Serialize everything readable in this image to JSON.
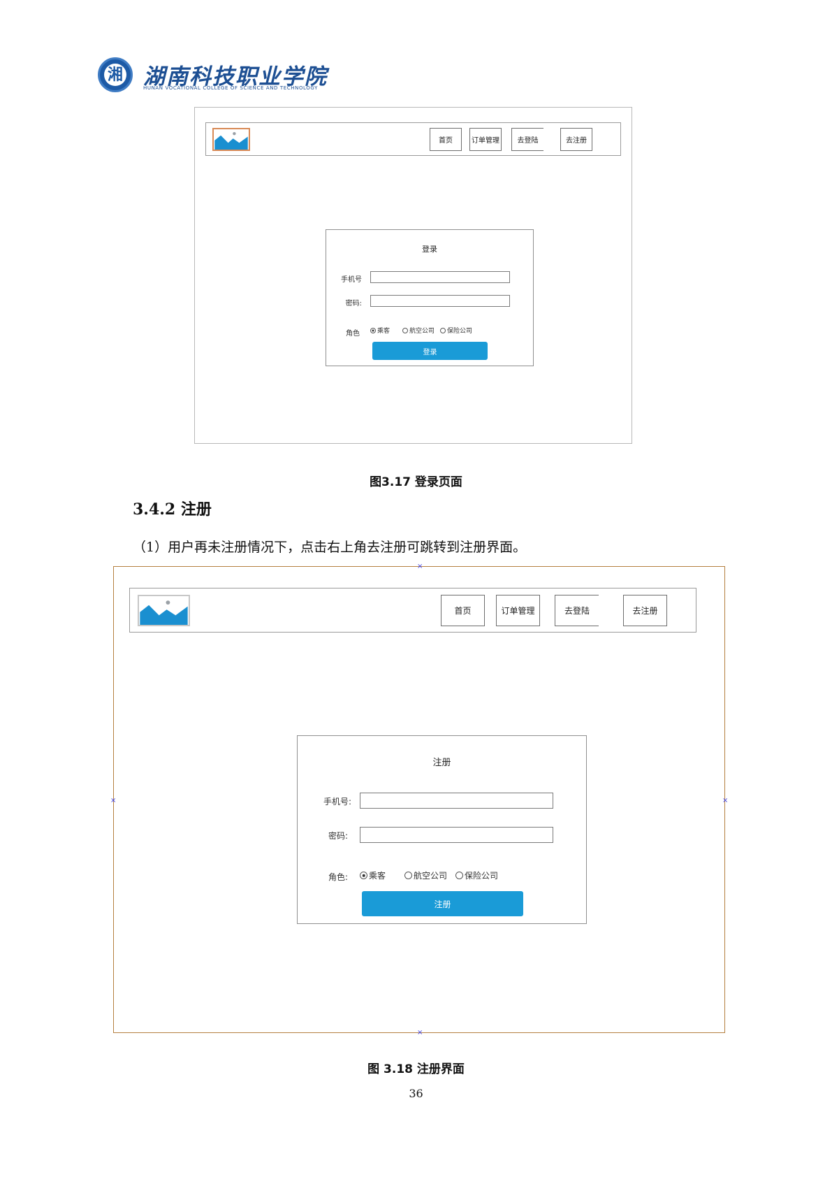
{
  "header": {
    "emblem_char": "湘",
    "college_name_cn": "湖南科技职业学院",
    "college_name_en": "HUNAN VOCATIONAL COLLEGE OF SCIENCE AND TECHNOLOGY"
  },
  "figure_login": {
    "nav": [
      "首页",
      "订单管理",
      "去登陆",
      "去注册"
    ],
    "form_title": "登录",
    "phone_label": "手机号",
    "password_label": "密码:",
    "role_label": "角色",
    "roles": [
      "乘客",
      "航空公司",
      "保险公司"
    ],
    "submit_label": "登录",
    "caption": "图3.17 登录页面"
  },
  "section": {
    "heading": "3.4.2 注册",
    "paragraph": "（1）用户再未注册情况下，点击右上角去注册可跳转到注册界面。"
  },
  "figure_register": {
    "nav": [
      "首页",
      "订单管理",
      "去登陆",
      "去注册"
    ],
    "form_title": "注册",
    "phone_label": "手机号:",
    "password_label": "密码:",
    "role_label": "角色:",
    "roles": [
      "乘客",
      "航空公司",
      "保险公司"
    ],
    "submit_label": "注册",
    "caption": "图 3.18 注册界面"
  },
  "colors": {
    "accent_button": "#1a9bd7",
    "brand_blue": "#1d4f93",
    "frame_orange": "#b57f3f"
  },
  "page_number": "36"
}
